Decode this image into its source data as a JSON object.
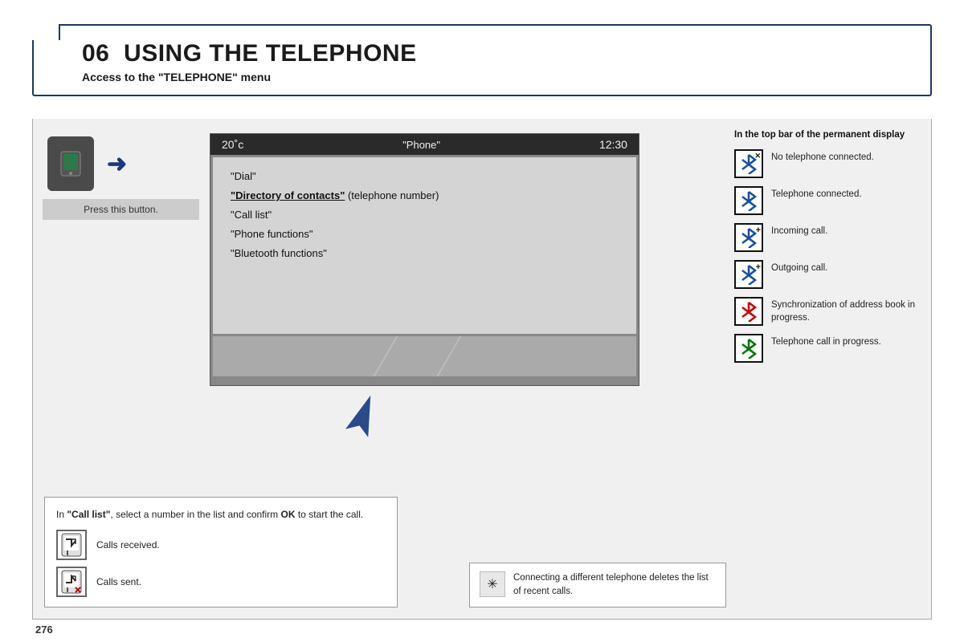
{
  "header": {
    "chapter": "06",
    "title": "USING THE TELEPHONE",
    "subtitle": "Access to the \"TELEPHONE\" menu"
  },
  "screen": {
    "temp": "20˚c",
    "menu_title": "\"Phone\"",
    "time": "12:30",
    "menu_items": [
      {
        "text": "\"Dial\"",
        "bold": false
      },
      {
        "text": "\"Directory of contacts\"",
        "suffix": " (telephone number)",
        "bold": true
      },
      {
        "text": "\"Call list\"",
        "bold": false
      },
      {
        "text": "\"Phone functions\"",
        "bold": false
      },
      {
        "text": "\"Bluetooth functions\"",
        "bold": false
      }
    ]
  },
  "press_label": "Press this button.",
  "right_panel": {
    "title": "In the top bar of the permanent display",
    "status_items": [
      {
        "icon_type": "no_connect",
        "text": "No telephone connected."
      },
      {
        "icon_type": "connected",
        "text": "Telephone connected."
      },
      {
        "icon_type": "incoming",
        "text": "Incoming call."
      },
      {
        "icon_type": "outgoing",
        "text": "Outgoing call."
      },
      {
        "icon_type": "sync",
        "text": "Synchronization of address book in progress."
      },
      {
        "icon_type": "call_in_progress",
        "text": "Telephone call in progress."
      }
    ]
  },
  "bottom_left": {
    "instruction": "In \"Call list\", select a number in the list and confirm OK to start the call.",
    "calls": [
      {
        "label": "Calls received."
      },
      {
        "label": "Calls sent."
      }
    ]
  },
  "bottom_note": {
    "text": "Connecting a different telephone deletes the list of recent calls."
  },
  "page_number": "276"
}
